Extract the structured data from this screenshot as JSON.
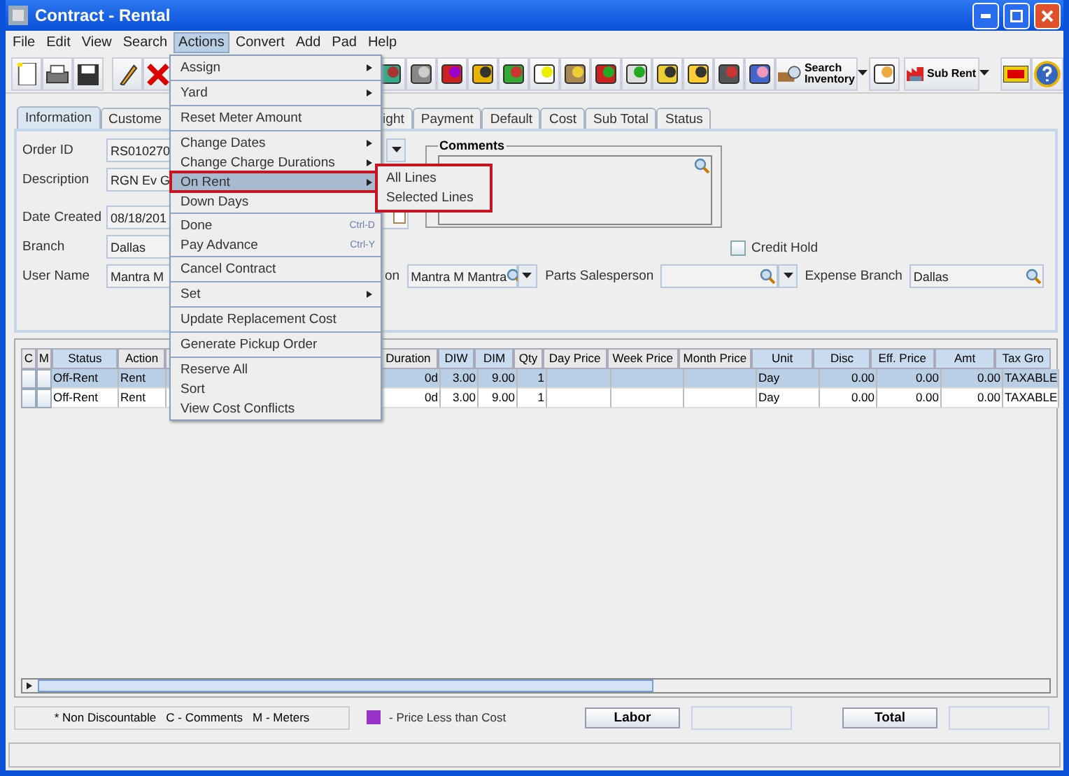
{
  "window": {
    "title": "Contract - Rental"
  },
  "menu_bar": [
    {
      "label": "File",
      "selected": false
    },
    {
      "label": "Edit",
      "selected": false
    },
    {
      "label": "View",
      "selected": false
    },
    {
      "label": "Search",
      "selected": false
    },
    {
      "label": "Actions",
      "selected": true
    },
    {
      "label": "Convert",
      "selected": false
    },
    {
      "label": "Add",
      "selected": false
    },
    {
      "label": "Pad",
      "selected": false
    },
    {
      "label": "Help",
      "selected": false
    }
  ],
  "toolbar": {
    "search_button": "Search\nInventory",
    "sub_rent_button": "Sub Rent"
  },
  "tabs": [
    {
      "label": "Information",
      "selected": true
    },
    {
      "label": "Custome",
      "selected": false
    },
    {
      "label": "ight",
      "selected": false
    },
    {
      "label": "Payment",
      "selected": false
    },
    {
      "label": "Default",
      "selected": false
    },
    {
      "label": "Cost",
      "selected": false
    },
    {
      "label": "Sub Total",
      "selected": false
    },
    {
      "label": "Status",
      "selected": false
    }
  ],
  "form": {
    "fields": [
      {
        "label": "Order ID",
        "value": "RS010270"
      },
      {
        "label": "Description",
        "value": "RGN Ev G"
      },
      {
        "label": "Date Created",
        "value": "08/18/201"
      },
      {
        "label": "Branch",
        "value": "Dallas"
      }
    ],
    "comments": {
      "label": "Comments"
    },
    "credit_hold": {
      "label": "Credit Hold",
      "checked": false
    },
    "user_name": {
      "label": "User Name",
      "value": "Mantra M"
    },
    "salesperson": {
      "label": "on",
      "value": "Mantra M Mantra"
    },
    "parts_salesperson": {
      "label": "Parts Salesperson"
    },
    "expense_branch": {
      "label": "Expense Branch",
      "value": "Dallas"
    }
  },
  "table": {
    "columns": [
      {
        "label": "C",
        "tinted": false
      },
      {
        "label": "M",
        "tinted": false
      },
      {
        "label": "Status",
        "tinted": true
      },
      {
        "label": "Action",
        "tinted": false
      },
      {
        "tinted": false
      },
      {
        "label": "Duration",
        "tinted": false
      },
      {
        "label": "DIW",
        "tinted": true
      },
      {
        "label": "DIM",
        "tinted": true
      },
      {
        "label": "Qty",
        "tinted": false
      },
      {
        "label": "Day Price",
        "tinted": false
      },
      {
        "label": "Week Price",
        "tinted": false
      },
      {
        "label": "Month Price",
        "tinted": false
      },
      {
        "label": "Unit",
        "tinted": true
      },
      {
        "label": "Disc",
        "tinted": true
      },
      {
        "label": "Eff. Price",
        "tinted": true
      },
      {
        "label": "Amt",
        "tinted": true
      },
      {
        "label": "Tax Gro",
        "tinted": true
      }
    ],
    "rows": [
      {
        "selected": true,
        "cells": [
          {
            "checked": false
          },
          {
            "checked": false
          },
          "Off-Rent",
          "Rent",
          null,
          "0d",
          "3.00",
          "9.00",
          "1",
          null,
          null,
          null,
          "Day",
          "0.00",
          "0.00",
          "0.00",
          "TAXABLE"
        ]
      },
      {
        "selected": false,
        "cells": [
          {
            "checked": false
          },
          {
            "checked": false
          },
          "Off-Rent",
          "Rent",
          null,
          "0d",
          "3.00",
          "9.00",
          "1",
          null,
          null,
          null,
          "Day",
          "0.00",
          "0.00",
          "0.00",
          "TAXABLE"
        ]
      }
    ]
  },
  "footer": {
    "legend": "* Non Discountable   C - Comments   M - Meters",
    "swatch_label": "- Price Less than Cost",
    "labor_button": "Labor",
    "total_button": "Total"
  },
  "actions_menu": [
    [
      {
        "label": "Assign",
        "kind": "submenu",
        "selected": false
      }
    ],
    [
      {
        "label": "Yard",
        "kind": "submenu",
        "selected": false
      }
    ],
    [
      {
        "label": "Reset Meter Amount",
        "kind": "plain",
        "selected": false
      }
    ],
    [
      {
        "label": "Change Dates",
        "kind": "submenu",
        "selected": false
      },
      {
        "label": "Change Charge Durations",
        "kind": "submenu",
        "selected": false
      },
      {
        "label": "On Rent",
        "kind": "submenu",
        "selected": true
      },
      {
        "label": "Down Days",
        "kind": "plain",
        "selected": false
      }
    ],
    [
      {
        "label": "Done",
        "kind": "shortcut",
        "shortcut": "Ctrl-D",
        "selected": false
      },
      {
        "label": "Pay Advance",
        "kind": "shortcut",
        "shortcut": "Ctrl-Y",
        "selected": false
      }
    ],
    [
      {
        "label": "Cancel Contract",
        "kind": "plain",
        "selected": false
      }
    ],
    [
      {
        "label": "Set",
        "kind": "submenu",
        "selected": false
      }
    ],
    [
      {
        "label": "Update Replacement Cost",
        "kind": "plain",
        "selected": false
      }
    ],
    [
      {
        "label": "Generate Pickup Order",
        "kind": "plain",
        "selected": false
      }
    ],
    [
      {
        "label": "Reserve All",
        "kind": "plain",
        "selected": false
      },
      {
        "label": "Sort",
        "kind": "plain",
        "selected": false
      },
      {
        "label": "View Cost Conflicts",
        "kind": "plain",
        "selected": false
      }
    ]
  ],
  "submenu": [
    {
      "label": "All Lines"
    },
    {
      "label": "Selected Lines"
    }
  ]
}
